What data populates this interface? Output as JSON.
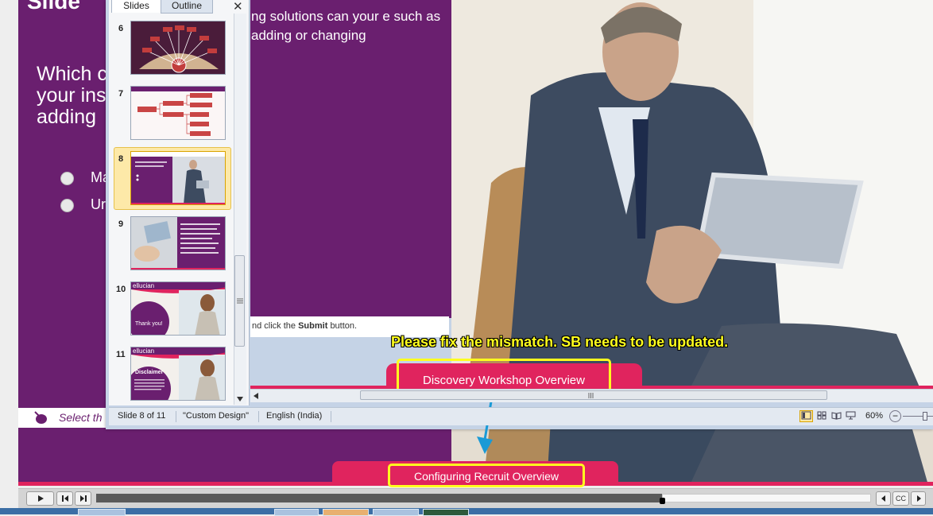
{
  "background_slide": {
    "title_fragment": "Slide",
    "question_fragment": "Which c your ins adding",
    "options": [
      "Ma",
      "Ur"
    ],
    "instruction_fragment": "Select th",
    "bottom_tab_label": "Configuring Recruit Overview"
  },
  "player": {
    "play_icon": "play-icon",
    "prev_icon": "skip-back-icon",
    "next_icon": "skip-forward-icon",
    "progress": 0.73,
    "back_icon": "chevron-left-icon",
    "cc_label": "CC",
    "forward_icon": "chevron-right-icon"
  },
  "ppt": {
    "tabs": {
      "slides": "Slides",
      "outline": "Outline"
    },
    "close_label": "✕",
    "thumbnails": [
      {
        "num": "6"
      },
      {
        "num": "7"
      },
      {
        "num": "8",
        "selected": true
      },
      {
        "num": "9"
      },
      {
        "num": "10",
        "caption": "Thank you!",
        "brand": "ellucian"
      },
      {
        "num": "11",
        "caption": "Disclaimer",
        "brand": "ellucian"
      }
    ],
    "editor": {
      "body_text": "ng solutions can your e such as adding or changing",
      "instruction_prefix": "nd click the",
      "instruction_bold": "Submit",
      "instruction_suffix": "button.",
      "tab_label": "Discovery Workshop Overview"
    },
    "status": {
      "slide_of": "Slide 8 of 11",
      "theme": "\"Custom Design\"",
      "language": "English (India)",
      "zoom": "60%",
      "zoom_out": "−"
    }
  },
  "annotation": {
    "comment": "Please fix the mismatch. SB needs to be updated."
  }
}
